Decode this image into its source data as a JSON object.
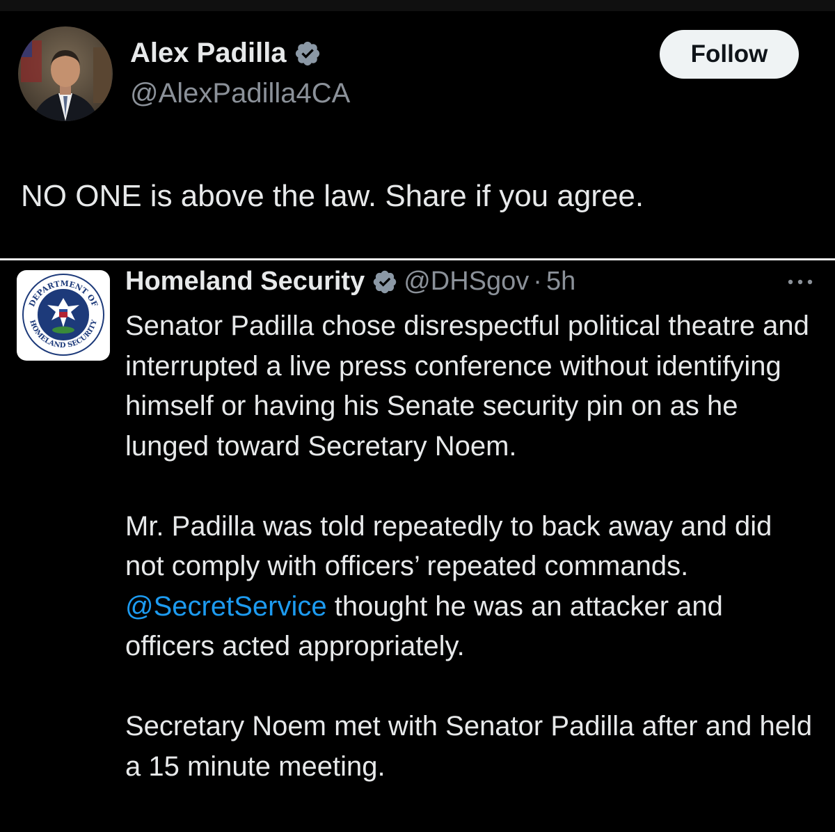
{
  "tweet": {
    "author_name": "Alex Padilla",
    "author_handle": "@AlexPadilla4CA",
    "follow_label": "Follow",
    "text": "NO ONE is above the law. Share if you agree."
  },
  "quoted": {
    "author_name": "Homeland Security",
    "author_handle": "@DHSgov",
    "separator": "·",
    "time": "5h",
    "paragraph1": "Senator Padilla chose disrespectful political theatre and interrupted a live press conference without identifying himself or having his Senate security pin on as he lunged toward Secretary Noem.",
    "paragraph2_before": "Mr. Padilla was told repeatedly to back away and did not comply with officers’ repeated commands.",
    "paragraph2_mention": "@SecretService",
    "paragraph2_after": "thought he was an attacker and officers acted appropriately.",
    "paragraph3": "Secretary Noem met with Senator Padilla after and held a 15 minute meeting.",
    "seal_text_top": "DEPARTMENT OF",
    "seal_text_bottom": "HOMELAND SECURITY"
  },
  "colors": {
    "background": "#000000",
    "text": "#e7e9ea",
    "secondary_text": "#8b9199",
    "link": "#1d9bf0",
    "verified_badge": "#8b98a5"
  },
  "icons": {
    "verified": "verified-badge-icon",
    "more": "more-options-icon"
  }
}
